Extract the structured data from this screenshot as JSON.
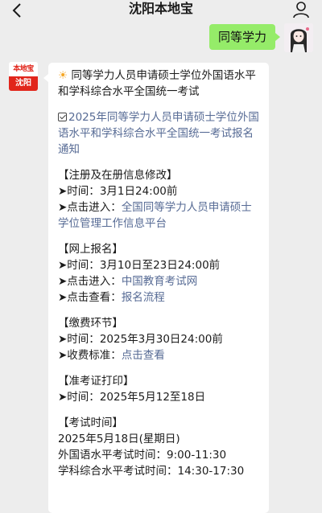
{
  "nav": {
    "title": "沈阳本地宝",
    "back_icon": "chevron-left-icon",
    "profile_icon": "person-icon"
  },
  "outgoing": {
    "text": "同等学力",
    "bubble_color": "#95ec69"
  },
  "bot_avatar": {
    "top_text": "本地宝",
    "bottom_text": "沈阳",
    "brand_color": "#e1251b"
  },
  "message": {
    "headline_icon": "sun-icon",
    "headline": "同等学力人员申请硕士学位外国语水平和学科综合水平全国统一考试",
    "notice_icon": "checkbox-icon",
    "notice_link": "2025年同等学力人员申请硕士学位外国语水平和学科综合水平全国统一考试报名通知",
    "sections": {
      "register": {
        "heading": "【注册及在册信息修改】",
        "time_label": "➤时间：",
        "time_value": "3月1日24:00前",
        "enter_label": "➤点击进入：",
        "enter_link": "全国同等学力人员申请硕士学位管理工作信息平台"
      },
      "online": {
        "heading": "【网上报名】",
        "time_label": "➤时间：",
        "time_value": "3月10日至23日24:00前",
        "enter_label": "➤点击进入：",
        "enter_link": "中国教育考试网",
        "view_label": "➤点击查看：",
        "view_link": "报名流程"
      },
      "payment": {
        "heading": "【缴费环节】",
        "time_label": "➤时间：",
        "time_value": "2025年3月30日24:00前",
        "fee_label": "➤收费标准：",
        "fee_link": "点击查看"
      },
      "admit": {
        "heading": "【准考证打印】",
        "time_label": "➤时间：",
        "time_value": "2025年5月12至18日"
      },
      "exam": {
        "heading": "【考试时间】",
        "date": "2025年5月18日(星期日)",
        "foreign": "外国语水平考试时间：9:00-11:30",
        "subject": "学科综合水平考试时间：14:30-17:30"
      }
    },
    "link_color": "#576b95"
  }
}
